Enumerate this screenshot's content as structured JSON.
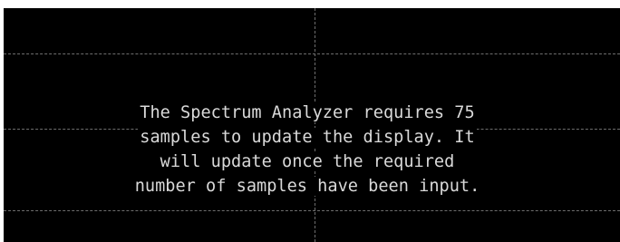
{
  "display": {
    "message_lines": [
      "The Spectrum Analyzer requires 75",
      "samples to update the display. It",
      "will update once the required",
      "number of samples have been input."
    ]
  },
  "colors": {
    "background": "#000000",
    "grid": "#6e6e6e",
    "text": "#d9d9d9"
  }
}
